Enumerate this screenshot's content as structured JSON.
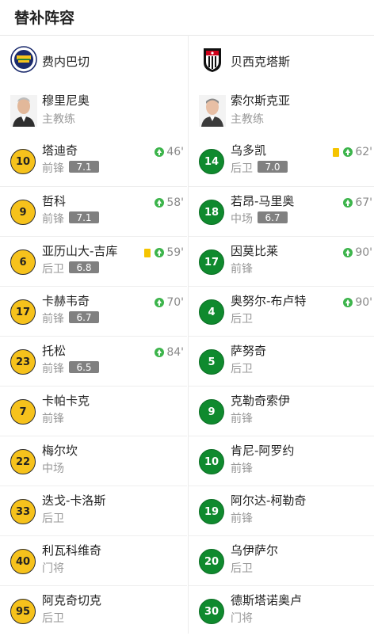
{
  "title": "替补阵容",
  "colors": {
    "home_badge": "#f6c21c",
    "away_badge": "#0f8a2e",
    "sub_in": "#3cb44b",
    "yellow_card": "#f5c400"
  },
  "home": {
    "team": "费内巴切",
    "coach": {
      "name": "穆里尼奥",
      "role": "主教练"
    },
    "players": [
      {
        "number": "10",
        "name": "塔迪奇",
        "position": "前锋",
        "rating": "7.1",
        "sub_minute": "46'",
        "yellow_card": false
      },
      {
        "number": "9",
        "name": "哲科",
        "position": "前锋",
        "rating": "7.1",
        "sub_minute": "58'",
        "yellow_card": false
      },
      {
        "number": "6",
        "name": "亚历山大-吉库",
        "position": "后卫",
        "rating": "6.8",
        "sub_minute": "59'",
        "yellow_card": true
      },
      {
        "number": "17",
        "name": "卡赫韦奇",
        "position": "前锋",
        "rating": "6.7",
        "sub_minute": "70'",
        "yellow_card": false
      },
      {
        "number": "23",
        "name": "托松",
        "position": "前锋",
        "rating": "6.5",
        "sub_minute": "84'",
        "yellow_card": false
      },
      {
        "number": "7",
        "name": "卡帕卡克",
        "position": "前锋",
        "rating": "",
        "sub_minute": "",
        "yellow_card": false
      },
      {
        "number": "22",
        "name": "梅尔坎",
        "position": "中场",
        "rating": "",
        "sub_minute": "",
        "yellow_card": false
      },
      {
        "number": "33",
        "name": "迭戈-卡洛斯",
        "position": "后卫",
        "rating": "",
        "sub_minute": "",
        "yellow_card": false
      },
      {
        "number": "40",
        "name": "利瓦科维奇",
        "position": "门将",
        "rating": "",
        "sub_minute": "",
        "yellow_card": false
      },
      {
        "number": "95",
        "name": "阿克奇切克",
        "position": "后卫",
        "rating": "",
        "sub_minute": "",
        "yellow_card": false
      }
    ]
  },
  "away": {
    "team": "贝西克塔斯",
    "coach": {
      "name": "索尔斯克亚",
      "role": "主教练"
    },
    "players": [
      {
        "number": "14",
        "name": "乌多凯",
        "position": "后卫",
        "rating": "7.0",
        "sub_minute": "62'",
        "yellow_card": true
      },
      {
        "number": "18",
        "name": "若昂-马里奥",
        "position": "中场",
        "rating": "6.7",
        "sub_minute": "67'",
        "yellow_card": false
      },
      {
        "number": "17",
        "name": "因莫比莱",
        "position": "前锋",
        "rating": "",
        "sub_minute": "90'",
        "yellow_card": false
      },
      {
        "number": "4",
        "name": "奥努尔-布卢特",
        "position": "后卫",
        "rating": "",
        "sub_minute": "90'",
        "yellow_card": false
      },
      {
        "number": "5",
        "name": "萨努奇",
        "position": "后卫",
        "rating": "",
        "sub_minute": "",
        "yellow_card": false
      },
      {
        "number": "9",
        "name": "克勒奇索伊",
        "position": "前锋",
        "rating": "",
        "sub_minute": "",
        "yellow_card": false
      },
      {
        "number": "10",
        "name": "肯尼-阿罗约",
        "position": "前锋",
        "rating": "",
        "sub_minute": "",
        "yellow_card": false
      },
      {
        "number": "19",
        "name": "阿尔达-柯勒奇",
        "position": "前锋",
        "rating": "",
        "sub_minute": "",
        "yellow_card": false
      },
      {
        "number": "20",
        "name": "乌伊萨尔",
        "position": "后卫",
        "rating": "",
        "sub_minute": "",
        "yellow_card": false
      },
      {
        "number": "30",
        "name": "德斯塔诺奥卢",
        "position": "门将",
        "rating": "",
        "sub_minute": "",
        "yellow_card": false
      }
    ]
  }
}
